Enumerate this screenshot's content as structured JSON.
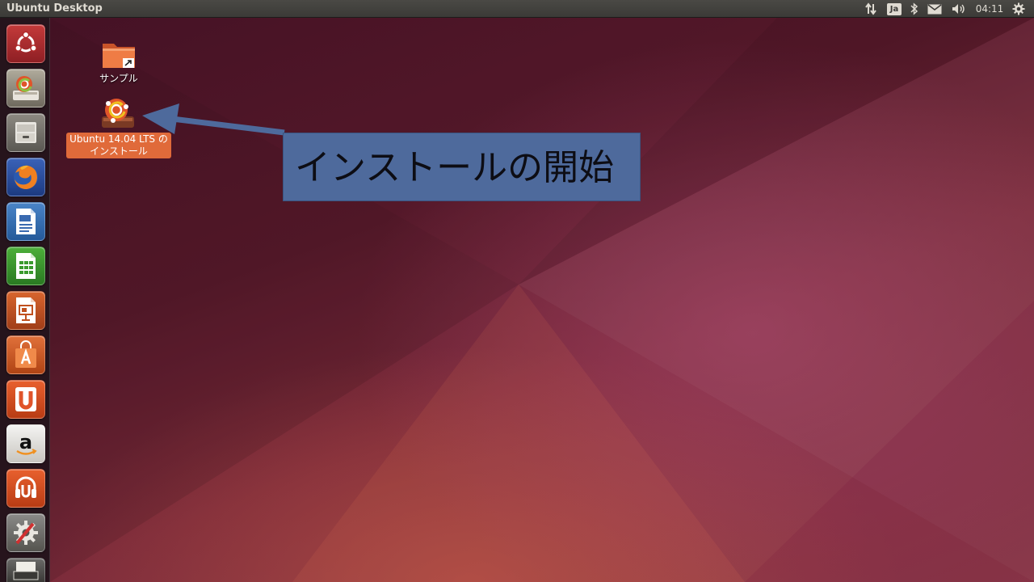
{
  "top_panel": {
    "window_title": "Ubuntu Desktop",
    "keyboard_layout": "Ja",
    "clock": "04:11",
    "icons": [
      "network-arrows-icon",
      "keyboard-indicator-icon",
      "bluetooth-icon",
      "mail-icon",
      "volume-icon",
      "settings-gear-icon"
    ]
  },
  "launcher": {
    "items": [
      {
        "name": "dash-home",
        "icon": "ubuntu-logo-icon"
      },
      {
        "name": "install-ubuntu",
        "icon": "installer-icon"
      },
      {
        "name": "files",
        "icon": "file-cabinet-icon"
      },
      {
        "name": "firefox",
        "icon": "firefox-icon"
      },
      {
        "name": "libreoffice-writer",
        "icon": "writer-document-icon"
      },
      {
        "name": "libreoffice-calc",
        "icon": "calc-spreadsheet-icon"
      },
      {
        "name": "libreoffice-impress",
        "icon": "impress-presentation-icon"
      },
      {
        "name": "software-center",
        "icon": "shopping-bag-icon"
      },
      {
        "name": "ubuntu-one",
        "icon": "ubuntu-one-icon"
      },
      {
        "name": "amazon",
        "icon": "amazon-icon"
      },
      {
        "name": "ubuntu-one-music",
        "icon": "music-store-icon"
      },
      {
        "name": "system-settings",
        "icon": "settings-tools-icon"
      },
      {
        "name": "trash",
        "icon": "trash-icon"
      }
    ]
  },
  "desktop": {
    "icons": [
      {
        "label": "サンプル",
        "icon": "folder-shortcut-icon"
      },
      {
        "label_line1": "Ubuntu 14.04 LTS の",
        "label_line2": "インストール",
        "icon": "installer-icon"
      }
    ]
  },
  "callout": {
    "text": "インストールの開始",
    "color": "#4e6a9c"
  },
  "colors": {
    "panel": "#3b3a37",
    "selection_orange": "#e06a3a",
    "launcher_bg": "#23161c"
  }
}
